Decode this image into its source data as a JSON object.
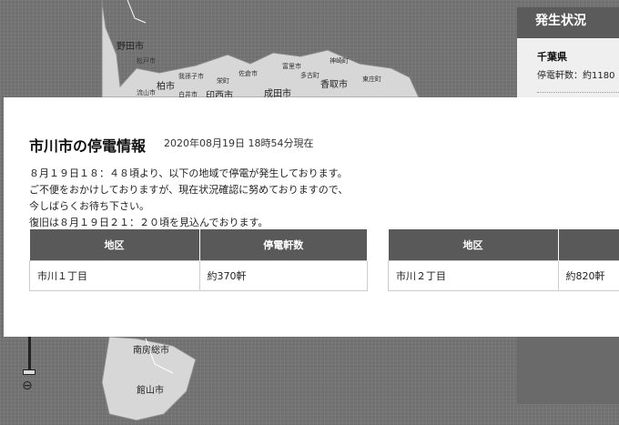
{
  "map": {
    "cities": [
      "野田市",
      "柏市",
      "印西市",
      "成田市",
      "香取市",
      "南房総市",
      "館山市",
      "我孫子市",
      "白井市",
      "佐倉市",
      "富里市",
      "多古町",
      "神崎町",
      "東庄町",
      "栄町",
      "流山市",
      "松戸市"
    ],
    "zoom_out_icon": "magnifier-minus"
  },
  "side_panel": {
    "title": "発生状況",
    "prefecture": "千葉県",
    "count_label": "停電軒数：約1180"
  },
  "modal": {
    "title": "市川市の停電情報",
    "timestamp": "2020年08月19日 18時54分現在",
    "messages": [
      "８月１９日１８：４８頃より、以下の地域で停電が発生しております。",
      "ご不便をおかけしておりますが、現在状況確認に努めておりますので、",
      "今しばらくお待ち下さい。",
      "復旧は８月１９日２１：２０頃を見込んでおります。"
    ],
    "table1": {
      "headers": [
        "地区",
        "停電軒数"
      ],
      "rows": [
        {
          "area": "市川１丁目",
          "count": "約370軒"
        }
      ]
    },
    "table2": {
      "headers": [
        "地区",
        ""
      ],
      "rows": [
        {
          "area": "市川２丁目",
          "count": "約820軒"
        }
      ]
    }
  }
}
